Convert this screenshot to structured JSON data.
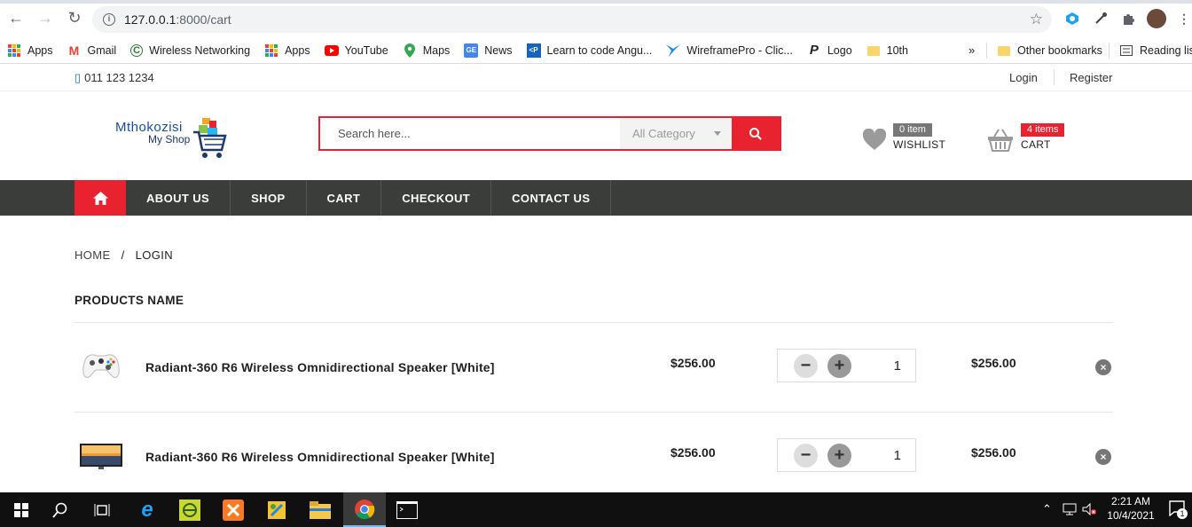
{
  "browser": {
    "url_host": "127.0.0.1",
    "url_path": ":8000/cart",
    "bookmarks": [
      {
        "label": "Apps",
        "icon": "apps-grid-icon"
      },
      {
        "label": "Gmail",
        "icon": "gmail-icon"
      },
      {
        "label": "Wireless Networking",
        "icon": "cisco-icon"
      },
      {
        "label": "Apps",
        "icon": "apps-grid-icon"
      },
      {
        "label": "YouTube",
        "icon": "youtube-icon"
      },
      {
        "label": "Maps",
        "icon": "maps-icon"
      },
      {
        "label": "News",
        "icon": "news-icon"
      },
      {
        "label": "Learn to code Angu...",
        "icon": "code-icon"
      },
      {
        "label": "WireframePro - Clic...",
        "icon": "wireframe-icon"
      },
      {
        "label": "Logo",
        "icon": "logo-p-icon"
      },
      {
        "label": "10th",
        "icon": "folder-icon"
      }
    ],
    "overflow": "»",
    "other_bookmarks": "Other bookmarks",
    "reading_list": "Reading list"
  },
  "topbar": {
    "phone": "011 123 1234",
    "login": "Login",
    "register": "Register"
  },
  "header": {
    "logo_line1": "Mthokozisi",
    "logo_line2": "My Shop",
    "search_placeholder": "Search here...",
    "category": "All Category",
    "wishlist_count": "0 item",
    "wishlist_label": "WISHLIST",
    "cart_count": "4 items",
    "cart_label": "CART"
  },
  "menu": {
    "items": [
      "ABOUT US",
      "SHOP",
      "CART",
      "CHECKOUT",
      "CONTACT US"
    ]
  },
  "breadcrumb": {
    "home": "HOME",
    "separator": "/",
    "current": "LOGIN"
  },
  "cart": {
    "heading": "PRODUCTS NAME",
    "rows": [
      {
        "name": "Radiant-360 R6 Wireless Omnidirectional Speaker [White]",
        "price": "$256.00",
        "qty": "1",
        "total": "$256.00",
        "thumb": "controller"
      },
      {
        "name": "Radiant-360 R6 Wireless Omnidirectional Speaker [White]",
        "price": "$256.00",
        "qty": "1",
        "total": "$256.00",
        "thumb": "tv"
      }
    ]
  },
  "taskbar": {
    "time": "2:21 AM",
    "date": "10/4/2021",
    "notifications": "1"
  },
  "colors": {
    "accent": "#e8232f",
    "menu_bg": "#3b3d3a",
    "taskbar": "#101010"
  }
}
